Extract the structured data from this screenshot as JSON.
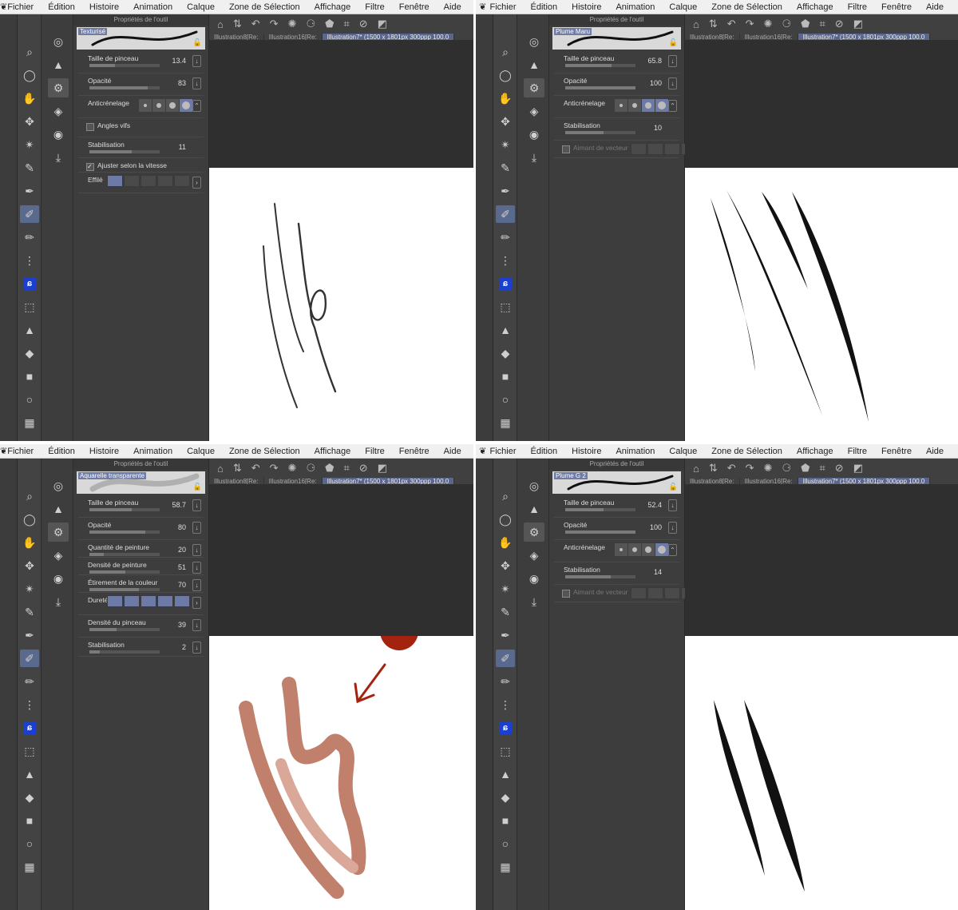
{
  "menu": [
    "Fichier",
    "Édition",
    "Histoire",
    "Animation",
    "Calque",
    "Zone de Sélection",
    "Affichage",
    "Filtre",
    "Fenêtre",
    "Aide"
  ],
  "props_title": "Propriétés de l'outil",
  "doc_tabs": [
    "Illustration8[Re:",
    "Illustration16[Re:",
    "Illustration7* (1500 x 1801px 300ppp 100.0"
  ],
  "panels": [
    {
      "brush": "Texturisé",
      "rows": [
        {
          "label": "Taille de pinceau",
          "value": "13.4",
          "fill": 0.36
        },
        {
          "label": "Opacité",
          "value": "83",
          "fill": 0.83
        },
        {
          "label": "Anticrénelage",
          "value": ""
        },
        {
          "label": "Angles vifs",
          "value": ""
        },
        {
          "label": "Stabilisation",
          "value": "11",
          "fill": 0.6
        },
        {
          "label": "Ajuster selon la vitesse",
          "value": ""
        },
        {
          "label": "Effilé",
          "value": ""
        }
      ]
    },
    {
      "brush": "Plume Maru",
      "rows": [
        {
          "label": "Taille de pinceau",
          "value": "65.8",
          "fill": 0.66
        },
        {
          "label": "Opacité",
          "value": "100",
          "fill": 1.0
        },
        {
          "label": "Anticrénelage",
          "value": ""
        },
        {
          "label": "Stabilisation",
          "value": "10",
          "fill": 0.55
        },
        {
          "label": "Aimant de vecteur",
          "value": ""
        }
      ]
    },
    {
      "brush": "Aquarelle transparente",
      "rows": [
        {
          "label": "Taille de pinceau",
          "value": "58.7",
          "fill": 0.6
        },
        {
          "label": "Opacité",
          "value": "80",
          "fill": 0.8
        },
        {
          "label": "Quantité de peinture",
          "value": "20",
          "fill": 0.2
        },
        {
          "label": "Densité de peinture",
          "value": "51",
          "fill": 0.51
        },
        {
          "label": "Étirement de la couleur",
          "value": "70",
          "fill": 0.7
        },
        {
          "label": "Dureté",
          "value": ""
        },
        {
          "label": "Densité du pinceau",
          "value": "39",
          "fill": 0.39
        },
        {
          "label": "Stabilisation",
          "value": "2",
          "fill": 0.15
        }
      ]
    },
    {
      "brush": "Plume G 2",
      "rows": [
        {
          "label": "Taille de pinceau",
          "value": "52.4",
          "fill": 0.55
        },
        {
          "label": "Opacité",
          "value": "100",
          "fill": 1.0
        },
        {
          "label": "Anticrénelage",
          "value": ""
        },
        {
          "label": "Stabilisation",
          "value": "14",
          "fill": 0.65
        },
        {
          "label": "Aimant de vecteur",
          "value": ""
        }
      ]
    }
  ],
  "colors": {
    "accent": "#6d7aa5",
    "watercolor": "#c0806c",
    "annotation": "#a3230f"
  }
}
